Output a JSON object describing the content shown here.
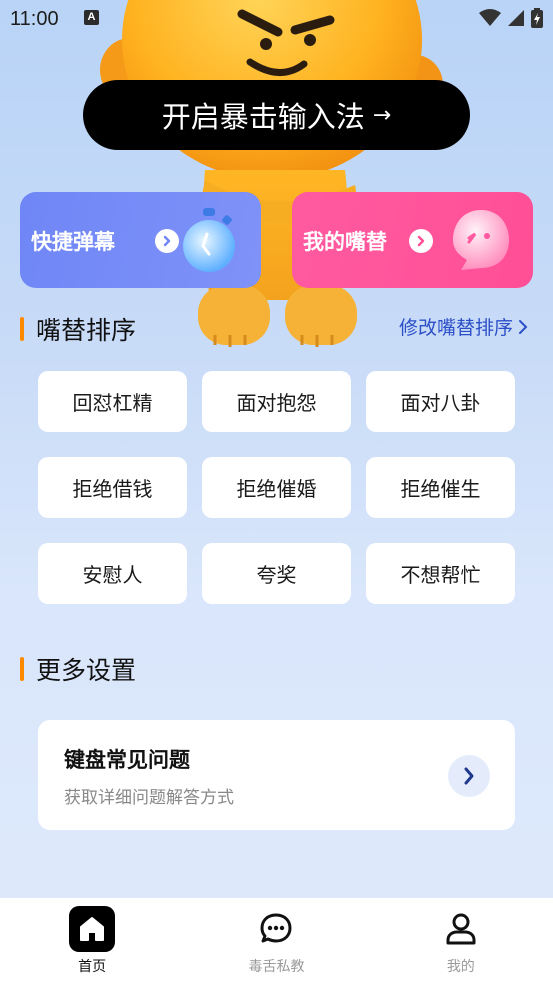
{
  "status_bar": {
    "time": "11:00",
    "notification_icon": "A"
  },
  "hero": {
    "cta_label": "开启暴击输入法",
    "cta_arrow": "→"
  },
  "cards": {
    "quick_barrage": {
      "label": "快捷弹幕",
      "icon": "stopwatch-icon"
    },
    "my_comebacks": {
      "label": "我的嘴替",
      "icon": "ghost-icon"
    }
  },
  "sort_section": {
    "title": "嘴替排序",
    "edit_link": "修改嘴替排序"
  },
  "tags": [
    "回怼杠精",
    "面对抱怨",
    "面对八卦",
    "拒绝借钱",
    "拒绝催婚",
    "拒绝催生",
    "安慰人",
    "夸奖",
    "不想帮忙"
  ],
  "more_section": {
    "title": "更多设置"
  },
  "faq": {
    "title": "键盘常见问题",
    "subtitle": "获取详细问题解答方式"
  },
  "tab_bar": {
    "home": "首页",
    "tutor": "毒舌私教",
    "mine": "我的"
  },
  "colors": {
    "accent_orange": "#ff8a00",
    "link_blue": "#2c4fc8",
    "card_blue": "#7386f7",
    "card_pink": "#ff559b"
  }
}
